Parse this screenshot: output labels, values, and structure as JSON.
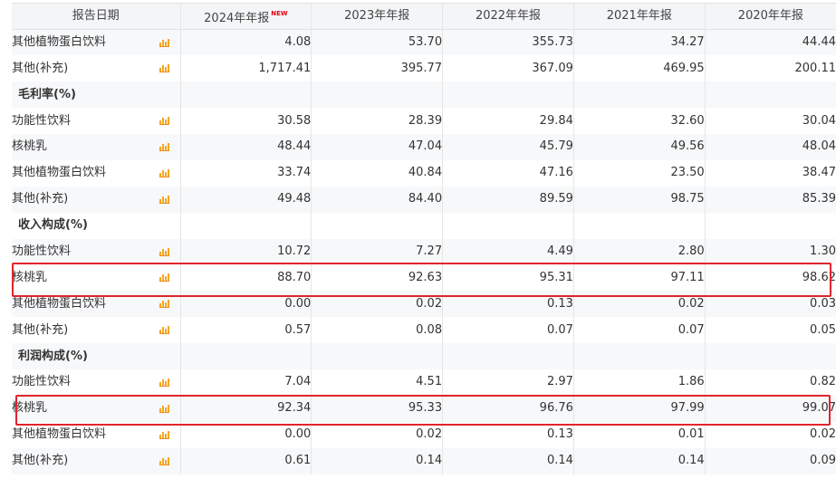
{
  "header": {
    "first_col": "报告日期",
    "years": [
      "2024年年报",
      "2023年年报",
      "2022年年报",
      "2021年年报",
      "2020年年报"
    ],
    "new_badge": "NEW"
  },
  "rows": [
    {
      "type": "item",
      "label": "其他植物蛋白饮料",
      "values": [
        "4.08",
        "53.70",
        "355.73",
        "34.27",
        "44.44"
      ]
    },
    {
      "type": "item",
      "label": "其他(补充)",
      "values": [
        "1,717.41",
        "395.77",
        "367.09",
        "469.95",
        "200.11"
      ]
    },
    {
      "type": "section",
      "label": "毛利率(%)"
    },
    {
      "type": "item",
      "label": "功能性饮料",
      "values": [
        "30.58",
        "28.39",
        "29.84",
        "32.60",
        "30.04"
      ]
    },
    {
      "type": "item",
      "label": "核桃乳",
      "values": [
        "48.44",
        "47.04",
        "45.79",
        "49.56",
        "48.04"
      ]
    },
    {
      "type": "item",
      "label": "其他植物蛋白饮料",
      "values": [
        "33.74",
        "40.84",
        "47.16",
        "23.50",
        "38.47"
      ]
    },
    {
      "type": "item",
      "label": "其他(补充)",
      "values": [
        "49.48",
        "84.40",
        "89.59",
        "98.75",
        "85.39"
      ]
    },
    {
      "type": "section",
      "label": "收入构成(%)"
    },
    {
      "type": "item",
      "label": "功能性饮料",
      "values": [
        "10.72",
        "7.27",
        "4.49",
        "2.80",
        "1.30"
      ]
    },
    {
      "type": "item",
      "label": "核桃乳",
      "values": [
        "88.70",
        "92.63",
        "95.31",
        "97.11",
        "98.62"
      ]
    },
    {
      "type": "item",
      "label": "其他植物蛋白饮料",
      "values": [
        "0.00",
        "0.02",
        "0.13",
        "0.02",
        "0.03"
      ]
    },
    {
      "type": "item",
      "label": "其他(补充)",
      "values": [
        "0.57",
        "0.08",
        "0.07",
        "0.07",
        "0.05"
      ]
    },
    {
      "type": "section",
      "label": "利润构成(%)"
    },
    {
      "type": "item",
      "label": "功能性饮料",
      "values": [
        "7.04",
        "4.51",
        "2.97",
        "1.86",
        "0.82"
      ]
    },
    {
      "type": "item",
      "label": "核桃乳",
      "values": [
        "92.34",
        "95.33",
        "96.76",
        "97.99",
        "99.07"
      ]
    },
    {
      "type": "item",
      "label": "其他植物蛋白饮料",
      "values": [
        "0.00",
        "0.02",
        "0.13",
        "0.01",
        "0.02"
      ]
    },
    {
      "type": "item",
      "label": "其他(补充)",
      "values": [
        "0.61",
        "0.14",
        "0.14",
        "0.14",
        "0.09"
      ]
    }
  ],
  "icons": {
    "row_chart": "bar-chart-icon"
  },
  "colors": {
    "highlight_border": "#e0242c",
    "chart_icon": "#f5a623",
    "new_badge": "#e60012"
  }
}
